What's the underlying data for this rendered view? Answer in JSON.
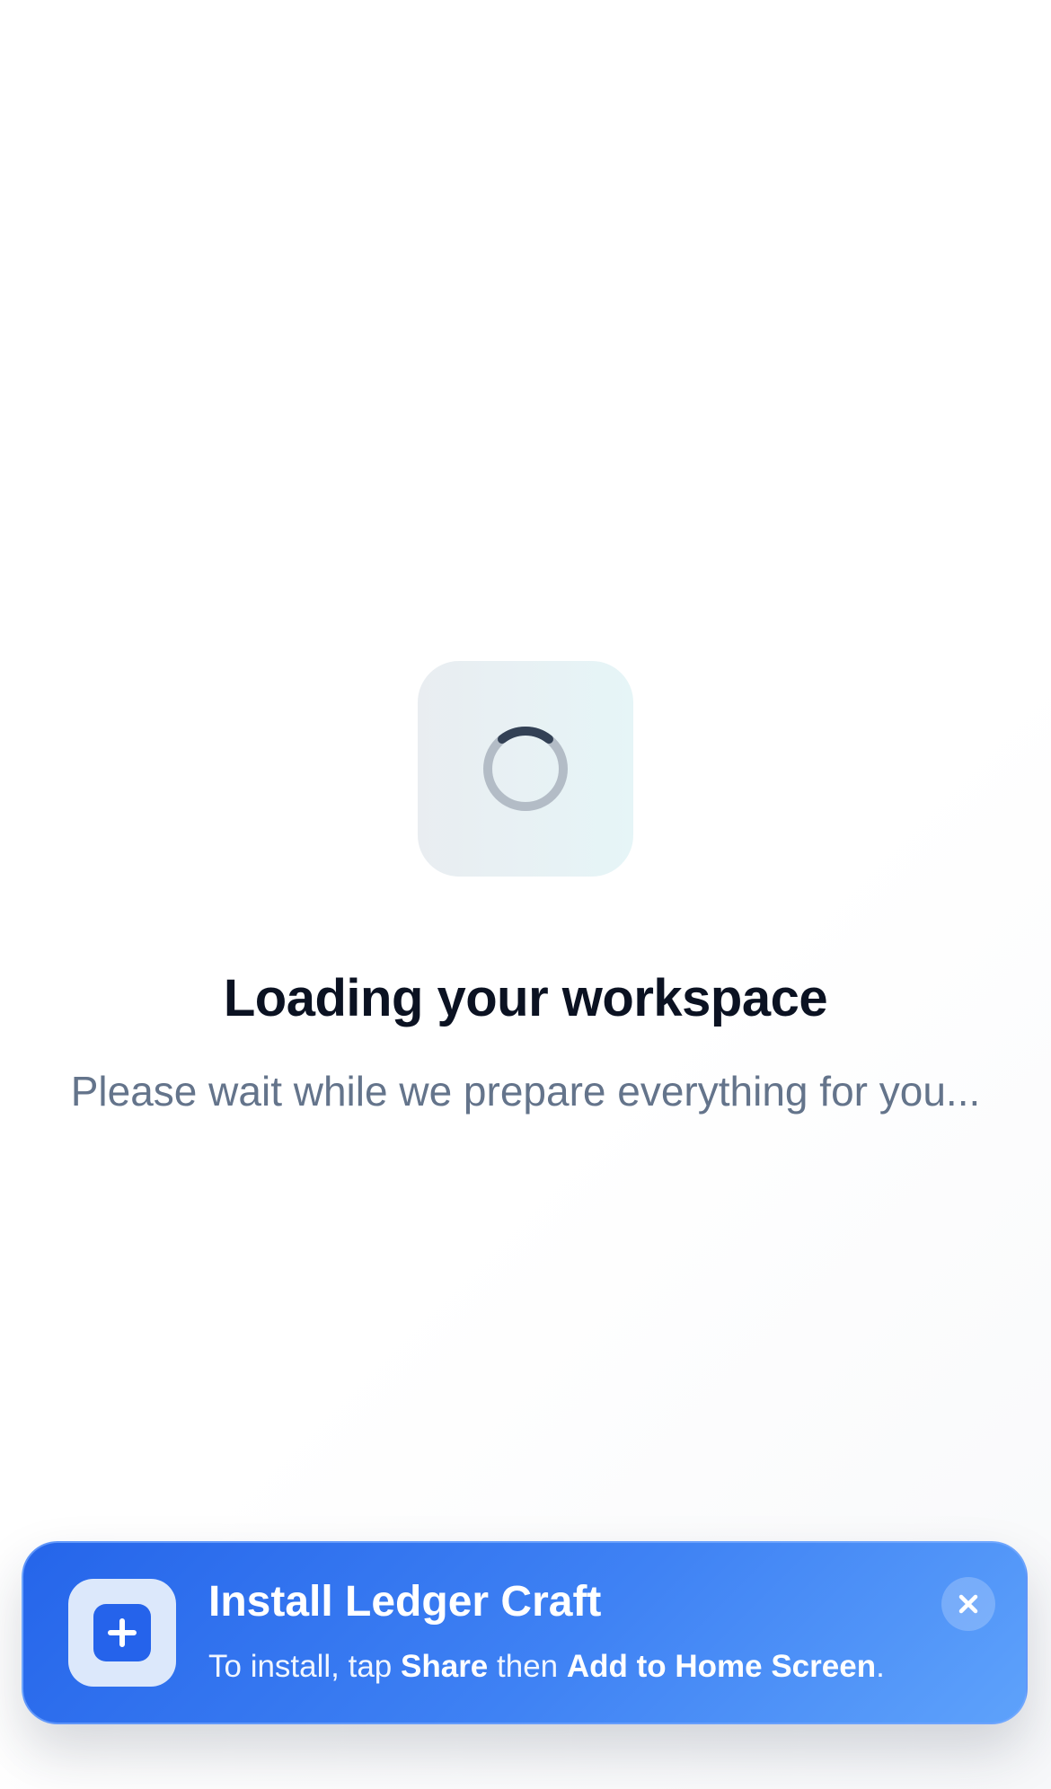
{
  "loading": {
    "title": "Loading your workspace",
    "subtitle": "Please wait while we prepare everything for you..."
  },
  "install_banner": {
    "title": "Install Ledger Craft",
    "instruction_prefix": "To install, tap ",
    "share_label": "Share",
    "instruction_middle": " then ",
    "add_label": "Add to Home Screen",
    "instruction_suffix": ".",
    "icon": "add-square-icon",
    "close_icon": "close-icon"
  },
  "colors": {
    "banner_start": "#2565ea",
    "banner_end": "#5ea2fb",
    "spinner_track": "#b3bcc6",
    "spinner_arc": "#334155",
    "title": "#0b1222",
    "subtitle": "#64748b"
  }
}
